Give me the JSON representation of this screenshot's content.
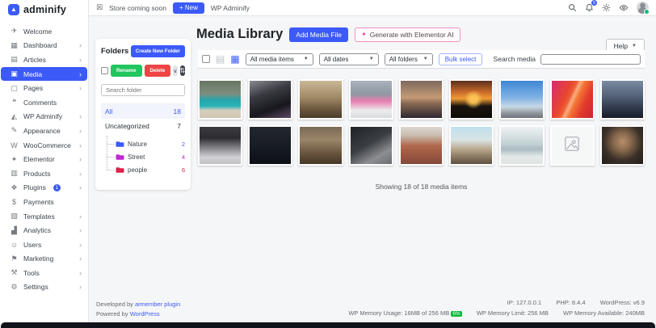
{
  "brand": {
    "name": "adminify"
  },
  "topbar": {
    "store_status": "Store coming soon",
    "new_button": "+ New",
    "site_name": "WP Adminify",
    "notification_count": "5"
  },
  "sidebar": {
    "items": [
      {
        "label": "Welcome",
        "icon": "paper-plane-icon",
        "chevron": false
      },
      {
        "label": "Dashboard",
        "icon": "dashboard-icon",
        "chevron": true
      },
      {
        "label": "Articles",
        "icon": "articles-icon",
        "chevron": true
      },
      {
        "label": "Media",
        "icon": "media-icon",
        "chevron": true,
        "active": true
      },
      {
        "label": "Pages",
        "icon": "pages-icon",
        "chevron": true
      },
      {
        "label": "Comments",
        "icon": "comments-icon",
        "chevron": false
      },
      {
        "label": "WP Adminify",
        "icon": "adminify-icon",
        "chevron": true
      },
      {
        "label": "Appearance",
        "icon": "appearance-icon",
        "chevron": true
      },
      {
        "label": "WooCommerce",
        "icon": "woocommerce-icon",
        "chevron": true
      },
      {
        "label": "Elementor",
        "icon": "elementor-icon",
        "chevron": true
      },
      {
        "label": "Products",
        "icon": "products-icon",
        "chevron": true
      },
      {
        "label": "Plugins",
        "icon": "plugins-icon",
        "chevron": true,
        "badge": "1"
      },
      {
        "label": "Payments",
        "icon": "payments-icon",
        "chevron": false
      },
      {
        "label": "Templates",
        "icon": "templates-icon",
        "chevron": true
      },
      {
        "label": "Analytics",
        "icon": "analytics-icon",
        "chevron": true
      },
      {
        "label": "Users",
        "icon": "users-icon",
        "chevron": true
      },
      {
        "label": "Marketing",
        "icon": "marketing-icon",
        "chevron": true
      },
      {
        "label": "Tools",
        "icon": "tools-icon",
        "chevron": true
      },
      {
        "label": "Settings",
        "icon": "settings-icon",
        "chevron": true
      }
    ]
  },
  "header": {
    "title": "Media Library",
    "add_media_button": "Add Media File",
    "generate_ai_button": "Generate with Elementor AI",
    "help_button": "Help"
  },
  "filters": {
    "media_type_select": "All media items",
    "date_select": "All dates",
    "folder_select": "All folders",
    "bulk_select_button": "Bulk select",
    "search_label": "Search media"
  },
  "folders_panel": {
    "title": "Folders",
    "create_button": "Create New Folder",
    "rename_button": "Rename",
    "delete_button": "Delete",
    "search_placeholder": "Search folder",
    "all_row": {
      "label": "All",
      "count": "18"
    },
    "uncategorized_row": {
      "label": "Uncategorized",
      "count": "7"
    },
    "tree": [
      {
        "label": "Nature",
        "count": "2",
        "color": "#3b5af7"
      },
      {
        "label": "Street",
        "count": "4",
        "color": "#c026d3"
      },
      {
        "label": "people",
        "count": "6",
        "color": "#e11d48"
      }
    ]
  },
  "media_grid": {
    "showing_text": "Showing 18 of 18 media items",
    "items": [
      {
        "name": "beach-lake-photo",
        "gradient": "linear-gradient(180deg,#667663 0%,#7e8d7f 35%,#22a6ab 52%,#2ab3b8 68%,#d8cfbc 80%,#cfc5b2 100%)"
      },
      {
        "name": "group-people-photo",
        "gradient": "linear-gradient(160deg,#8a8a92 0%,#3a3a42 35%,#17171d 70%,#5d4a66 100%)"
      },
      {
        "name": "dog-walk-photo",
        "gradient": "linear-gradient(180deg,#c9b796 0%,#a08a66 45%,#6e5940 75%,#4a3a28 100%)"
      },
      {
        "name": "pink-jacket-photo",
        "gradient": "linear-gradient(180deg,#aab2bc 0%,#8f98a4 35%,#e87fb0 55%,#ececee 80%,#d9dadd 100%)"
      },
      {
        "name": "dusk-horizon-photo",
        "gradient": "linear-gradient(180deg,#7d6a60 0%,#c49a74 45%,#8a6a55 60%,#2e2730 100%)"
      },
      {
        "name": "sunset-photo",
        "gradient": "radial-gradient(circle at 55% 50%, rgba(255,200,90,0.9) 0 12%, rgba(255,170,60,0) 32%), linear-gradient(180deg,#5a2f1c 0%,#c96a2a 30%,#ee9a34 48%,#1a140f 68%,#0e0b08 100%)"
      },
      {
        "name": "sky-city-photo",
        "gradient": "linear-gradient(180deg,#3f87d4 0%,#7fb2e4 45%,#c8d8e6 70%,#8e9399 88%,#6f747a 100%)"
      },
      {
        "name": "red-abstract-photo",
        "gradient": "linear-gradient(115deg, rgba(255,255,255,0) 44%, rgba(255,220,200,0.55) 50%, rgba(255,255,255,0) 57%), linear-gradient(115deg,#d42c74 0%,#e8452f 35%,#f57d35 55%,#e23a2c 75%,#c92430 100%)"
      },
      {
        "name": "street-dusk-photo",
        "gradient": "linear-gradient(180deg,#7a8aa0 0%,#55647a 40%,#333d4e 70%,#171d28 100%)"
      },
      {
        "name": "bridge-snow-photo",
        "gradient": "linear-gradient(180deg,#3c3c40 0%,#2c2c31 30%,#7e7e83 55%,#d2d2d6 82%,#c0c0c5 100%)"
      },
      {
        "name": "night-street-photo",
        "gradient": "linear-gradient(180deg,#23272e 0%,#171b22 55%,#0d1016 100%)"
      },
      {
        "name": "alley-photo",
        "gradient": "linear-gradient(180deg,#7a6a55 0%,#9a8568 35%,#6a563f 70%,#463625 100%)"
      },
      {
        "name": "van-night-photo",
        "gradient": "linear-gradient(150deg,#1f2226 0%,#3a3d42 45%,#8c8e92 75%,#6a6c70 100%)"
      },
      {
        "name": "rooftops-aerial-photo",
        "gradient": "linear-gradient(180deg,#ded7ce 0%,#c9bfb3 22%,#b06a4e 50%,#9c5741 75%,#82493a 100%)"
      },
      {
        "name": "mountain-street-photo",
        "gradient": "linear-gradient(180deg,#bfe0ee 0%,#d8e4e4 35%,#b9a98e 60%,#8a7a62 80%,#5f523f 100%)"
      },
      {
        "name": "pale-mountain-photo",
        "gradient": "linear-gradient(180deg,#eef2f3 0%,#c4d2d6 45%,#aabcc2 60%,#e4e8e6 80%,#dfe3e1 100%)"
      },
      {
        "name": "image-placeholder",
        "type": "placeholder"
      },
      {
        "name": "portrait-photo",
        "gradient": "radial-gradient(circle at 50% 40%,#b88e6a 0%,#8a6a4e 28%,#3a3028 62%,#211d1a 100%)"
      }
    ]
  },
  "footer": {
    "developed_by": "Developed by",
    "developer_link": "armember plugin",
    "powered_by": "Powered by",
    "powered_link": "WordPress",
    "ip": "IP: 127.0.0.1",
    "php": "PHP: 8.4.4",
    "wordpress": "WordPress: v6.9",
    "memory_usage": "WP Memory Usage: 16MB of 256 MB",
    "memory_usage_pct": "6%",
    "memory_limit": "WP Memory Limit: 256 MB",
    "memory_available": "WP Memory Available: 240MB"
  },
  "colors": {
    "primary": "#3b5af7",
    "green": "#22c55e",
    "red": "#ef4444",
    "pink": "#ec4899"
  }
}
